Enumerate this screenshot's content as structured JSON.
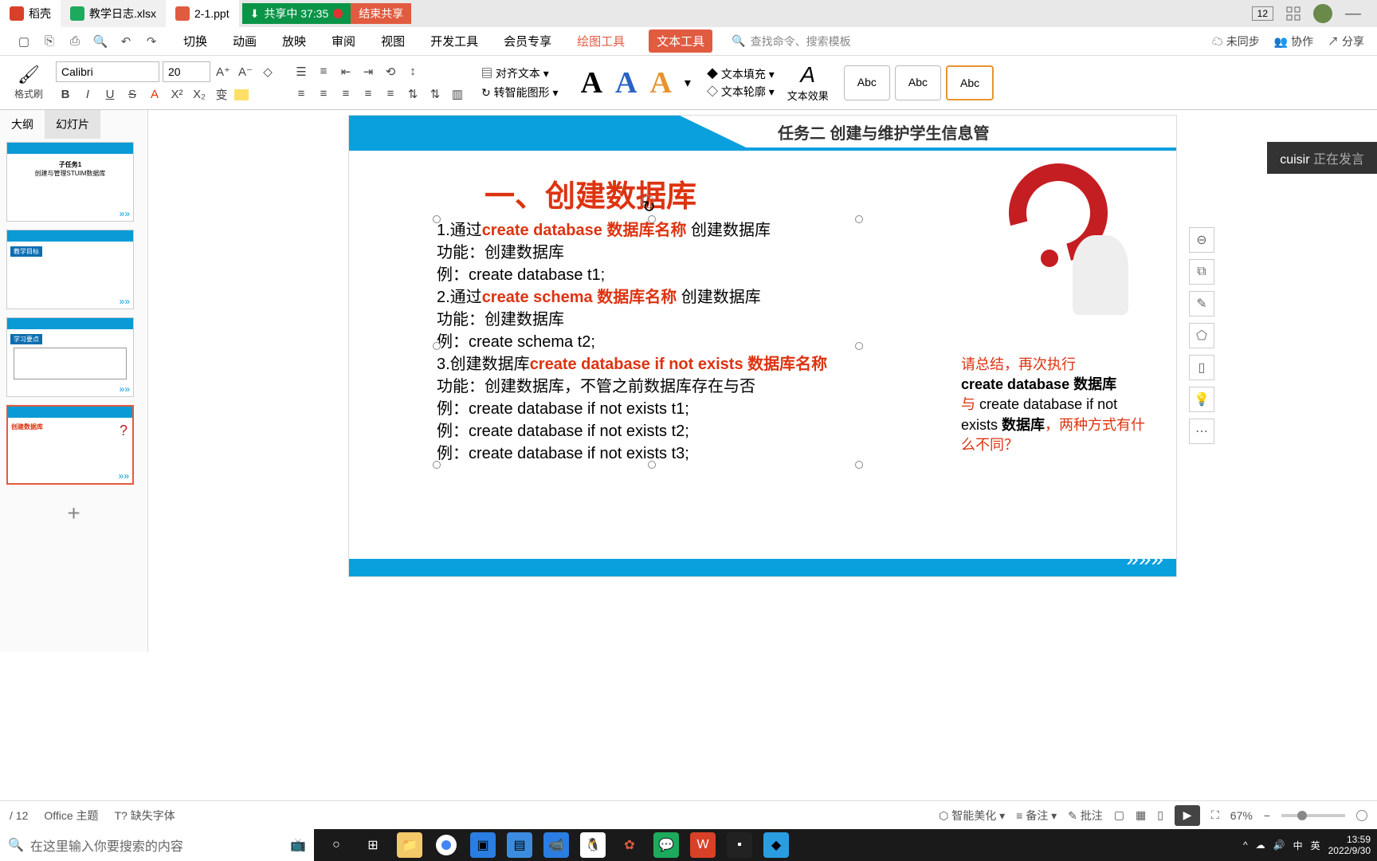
{
  "tabs": {
    "docell": "稻壳",
    "xlsx": "教学日志.xlsx",
    "ppt": "2-1.ppt"
  },
  "share": {
    "label": "共享中 37:35",
    "end": "结束共享"
  },
  "window_badge": "12",
  "menu": {
    "switch": "切换",
    "anim": "动画",
    "play": "放映",
    "review": "审阅",
    "view": "视图",
    "dev": "开发工具",
    "member": "会员专享",
    "draw": "绘图工具",
    "text": "文本工具"
  },
  "search_placeholder": "查找命令、搜索模板",
  "menu_right": {
    "unsync": "未同步",
    "collab": "协作",
    "share": "分享"
  },
  "toolbar": {
    "format_painter": "格式刷",
    "font": "Calibri",
    "size": "20",
    "align_text": "对齐文本",
    "smart_graphic": "转智能图形",
    "text_fill": "文本填充",
    "text_outline": "文本轮廓",
    "text_effect": "文本效果",
    "style_abc": "Abc"
  },
  "side_tabs": {
    "outline": "大纲",
    "slides": "幻灯片"
  },
  "thumbs": {
    "t1": {
      "title": "子任务1",
      "sub": "创建与管理STUIM数据库"
    },
    "t2": "教学目标",
    "t3": "学习要点",
    "t4": "创建数据库"
  },
  "slide": {
    "header": "任务二 创建与维护学生信息管",
    "heading": "一、创建数据库",
    "l1a": "1.通过",
    "l1b": "create  database  数据库名称",
    "l1c": " 创建数据库",
    "l2": "功能：创建数据库",
    "l3": "例：create  database  t1;",
    "l4a": "2.通过",
    "l4b": "create  schema 数据库名称",
    "l4c": "  创建数据库",
    "l5": "功能：创建数据库",
    "l6": "例：create schema t2;",
    "l7a": "3.创建数据库",
    "l7b": "create database if not exists 数据库名称",
    "l8": "功能：创建数据库，不管之前数据库存在与否",
    "l9": "例：create database if not exists t1;",
    "l10": "例：create database if not exists t2;",
    "l11": "例：create database if not exists t3;",
    "side1": "请总结，再次执行",
    "side2": "create database 数据库",
    "side3a": "与 ",
    "side3b": "create database if not exists  ",
    "side3c": "数据库",
    "side3d": "，",
    "side4": "两种方式有什么不同？"
  },
  "notif": {
    "name": "cuisir",
    "status": "正在发言"
  },
  "status": {
    "page": "/ 12",
    "theme": "Office 主题",
    "font": "缺失字体",
    "beautify": "智能美化",
    "note": "备注",
    "comment": "批注",
    "zoom": "67%"
  },
  "taskbar": {
    "search": "在这里输入你要搜索的内容",
    "ime1": "中",
    "ime2": "英",
    "time": "13:59",
    "date": "2022/9/30"
  }
}
